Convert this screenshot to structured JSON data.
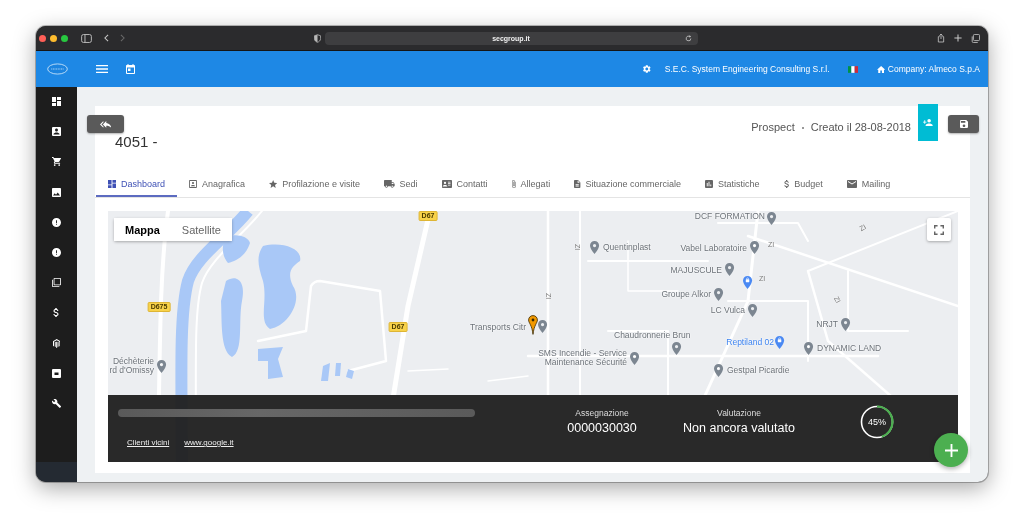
{
  "browser": {
    "url": "secgroup.it"
  },
  "header": {
    "organization": "S.E.C. System Engineering Consulting S.r.l.",
    "company": "Company: Almeco S.p.A"
  },
  "record": {
    "title": "4051 -",
    "status": "Prospect",
    "created": "Creato il 28-08-2018"
  },
  "tabs": [
    {
      "label": "Dashboard",
      "selected": true
    },
    {
      "label": "Anagrafica",
      "selected": false
    },
    {
      "label": "Profilazione e visite",
      "selected": false
    },
    {
      "label": "Sedi",
      "selected": false
    },
    {
      "label": "Contatti",
      "selected": false
    },
    {
      "label": "Allegati",
      "selected": false
    },
    {
      "label": "Situazione commerciale",
      "selected": false
    },
    {
      "label": "Statistiche",
      "selected": false
    },
    {
      "label": "Budget",
      "selected": false
    },
    {
      "label": "Mailing",
      "selected": false
    }
  ],
  "map": {
    "map_types": [
      {
        "label": "Mappa",
        "selected": true
      },
      {
        "label": "Satellite",
        "selected": false
      }
    ],
    "places": [
      {
        "kind": "road",
        "label": "D67"
      },
      {
        "kind": "poi",
        "label": "DCF FORMATION"
      },
      {
        "kind": "street",
        "label": "ZI"
      },
      {
        "kind": "street",
        "label": "ZI"
      },
      {
        "kind": "poi",
        "label": "Quentinplast"
      },
      {
        "kind": "poi",
        "label": "Vabel Laboratoire"
      },
      {
        "kind": "street",
        "label": "ZI"
      },
      {
        "kind": "poi",
        "label": "MAJUSCULE"
      },
      {
        "kind": "shop"
      },
      {
        "kind": "street",
        "label": "ZI"
      },
      {
        "kind": "street",
        "label": "ZI"
      },
      {
        "kind": "poi",
        "label": "Groupe Alkor"
      },
      {
        "kind": "street",
        "label": "ZI"
      },
      {
        "kind": "road",
        "label": "D675"
      },
      {
        "kind": "poi",
        "label": "LC Vulca"
      },
      {
        "kind": "road",
        "label": "D67"
      },
      {
        "kind": "poi",
        "label": "Transports Citr"
      },
      {
        "kind": "marker"
      },
      {
        "kind": "poi",
        "label": "NRJT"
      },
      {
        "kind": "poi",
        "label": "Chaudronnerie Brun"
      },
      {
        "kind": "shop",
        "label": "Reptiland 02"
      },
      {
        "kind": "poi",
        "label": "DYNAMIC LAND"
      },
      {
        "kind": "poi",
        "label": "Déchèterie\nrd d'Omissy"
      },
      {
        "kind": "poi",
        "label": "SMS Incendie - Service\nMaintenance Sécurité"
      },
      {
        "kind": "poi",
        "label": "Gestpal Picardie"
      }
    ],
    "info": {
      "links": [
        "Clienti vicini",
        "www.google.it"
      ],
      "fields": [
        {
          "label": "Assegnazione",
          "value": "0000030030"
        },
        {
          "label": "Valutazione",
          "value": "Non ancora valutato"
        }
      ],
      "rating": {
        "level": 0.45,
        "reading": "45%"
      }
    }
  }
}
